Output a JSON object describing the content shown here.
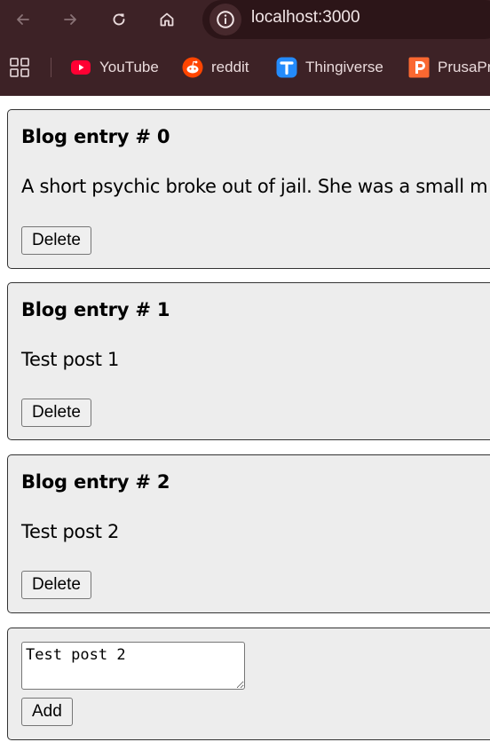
{
  "browser": {
    "url": "localhost:3000",
    "nav_icons": [
      "back-arrow-icon",
      "forward-arrow-icon",
      "reload-icon",
      "home-icon",
      "site-info-icon"
    ],
    "bookmarks": [
      {
        "label": "YouTube",
        "icon": "youtube-icon",
        "color": "#ff0033"
      },
      {
        "label": "reddit",
        "icon": "reddit-icon",
        "color": "#ff4500"
      },
      {
        "label": "Thingiverse",
        "icon": "thingiverse-icon",
        "color": "#248bfb"
      },
      {
        "label": "PrusaPr",
        "icon": "prusa-icon",
        "color": "#fa6831"
      }
    ]
  },
  "posts": [
    {
      "title": "Blog entry # 0",
      "body": "A short psychic broke out of jail. She was a small m",
      "delete_label": "Delete"
    },
    {
      "title": "Blog entry # 1",
      "body": "Test post 1",
      "delete_label": "Delete"
    },
    {
      "title": "Blog entry # 2",
      "body": "Test post 2",
      "delete_label": "Delete"
    }
  ],
  "composer": {
    "textarea_value": "Test post 2",
    "add_label": "Add"
  },
  "colors": {
    "chrome_bg": "#3d2226",
    "card_bg": "#ededed"
  }
}
